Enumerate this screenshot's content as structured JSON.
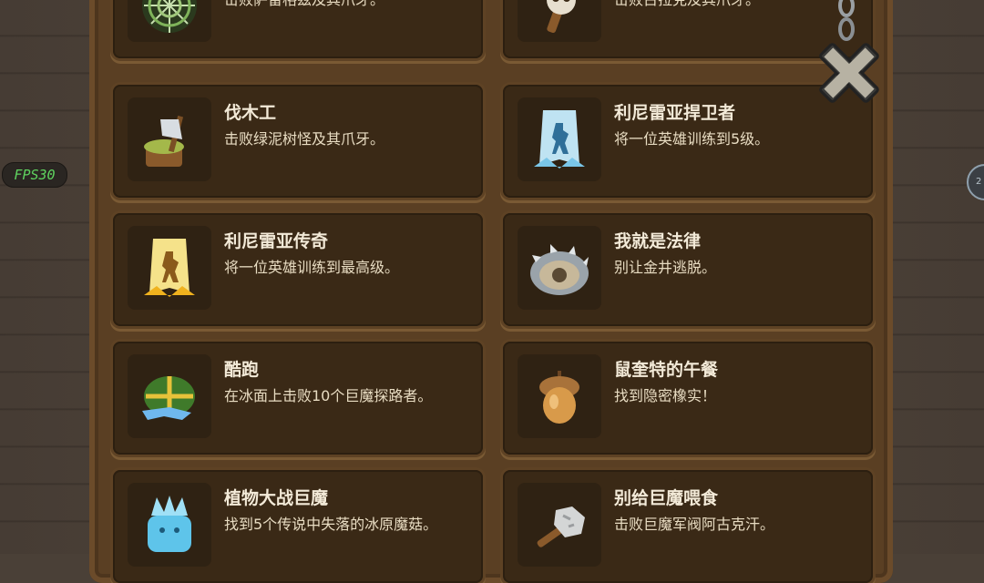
{
  "overlay": {
    "fps_label": "FPS30",
    "side_button_label": "2"
  },
  "achievements": [
    {
      "title": "",
      "desc": "击败萨雷格兹及其爪牙。",
      "icon": "spider-web-icon"
    },
    {
      "title": "",
      "desc": "击败古拉克及其爪牙。",
      "icon": "skull-staff-icon"
    },
    {
      "title": "伐木工",
      "desc": "击败绿泥树怪及其爪牙。",
      "icon": "axe-stump-icon"
    },
    {
      "title": "利尼雷亚捍卫者",
      "desc": "将一位英雄训练到5级。",
      "icon": "blue-hero-banner-icon"
    },
    {
      "title": "利尼雷亚传奇",
      "desc": "将一位英雄训练到最高级。",
      "icon": "gold-hero-banner-icon"
    },
    {
      "title": "我就是法律",
      "desc": "别让金井逃脱。",
      "icon": "spiked-shield-icon"
    },
    {
      "title": "酷跑",
      "desc": "在冰面上击败10个巨魔探路者。",
      "icon": "runner-helmet-icon"
    },
    {
      "title": "鼠奎特的午餐",
      "desc": "找到隐密橡实！",
      "icon": "acorn-icon"
    },
    {
      "title": "植物大战巨魔",
      "desc": "找到5个传说中失落的冰原魔菇。",
      "icon": "ice-crystal-plant-icon"
    },
    {
      "title": "别给巨魔喂食",
      "desc": "击败巨魔军阀阿古克汗。",
      "icon": "stone-club-icon"
    }
  ],
  "colors": {
    "card_bg": "#3a2916",
    "frame": "#5a3f23",
    "title_text": "#f3ead8",
    "fps_text": "#5fd35f"
  }
}
